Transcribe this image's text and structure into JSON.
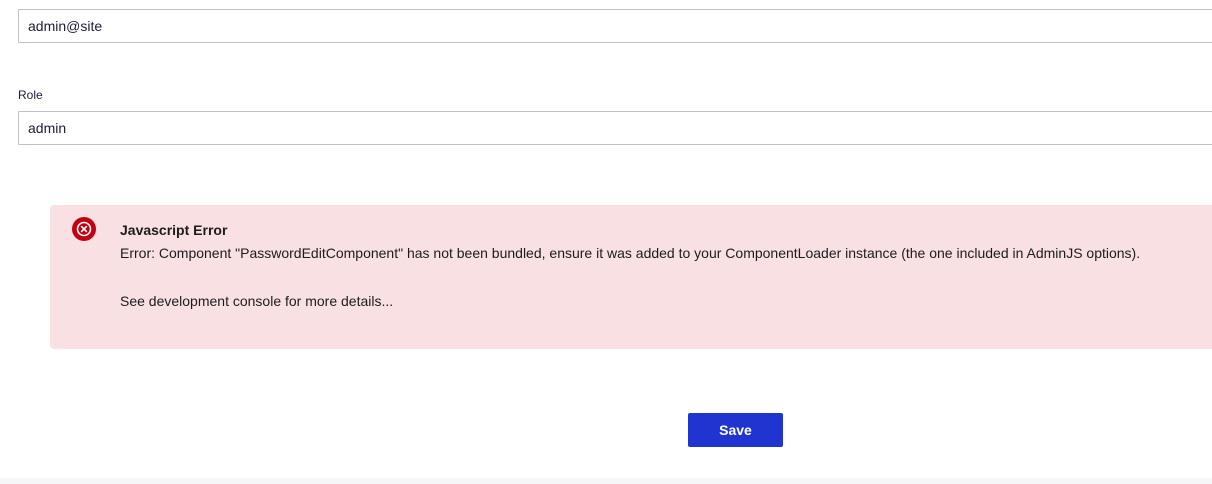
{
  "form": {
    "email": {
      "value": "admin@site"
    },
    "role": {
      "label": "Role",
      "value": "admin"
    },
    "save_label": "Save"
  },
  "error": {
    "icon": "circle-x-icon",
    "title": "Javascript Error",
    "message": "Error: Component \"PasswordEditComponent\" has not been bundled, ensure it was added to your ComponentLoader instance (the one included in AdminJS options).",
    "hint": "See development console for more details...",
    "colors": {
      "background": "#f9e0e3",
      "icon": "#c20012"
    }
  },
  "colors": {
    "accent": "#2035d0"
  }
}
